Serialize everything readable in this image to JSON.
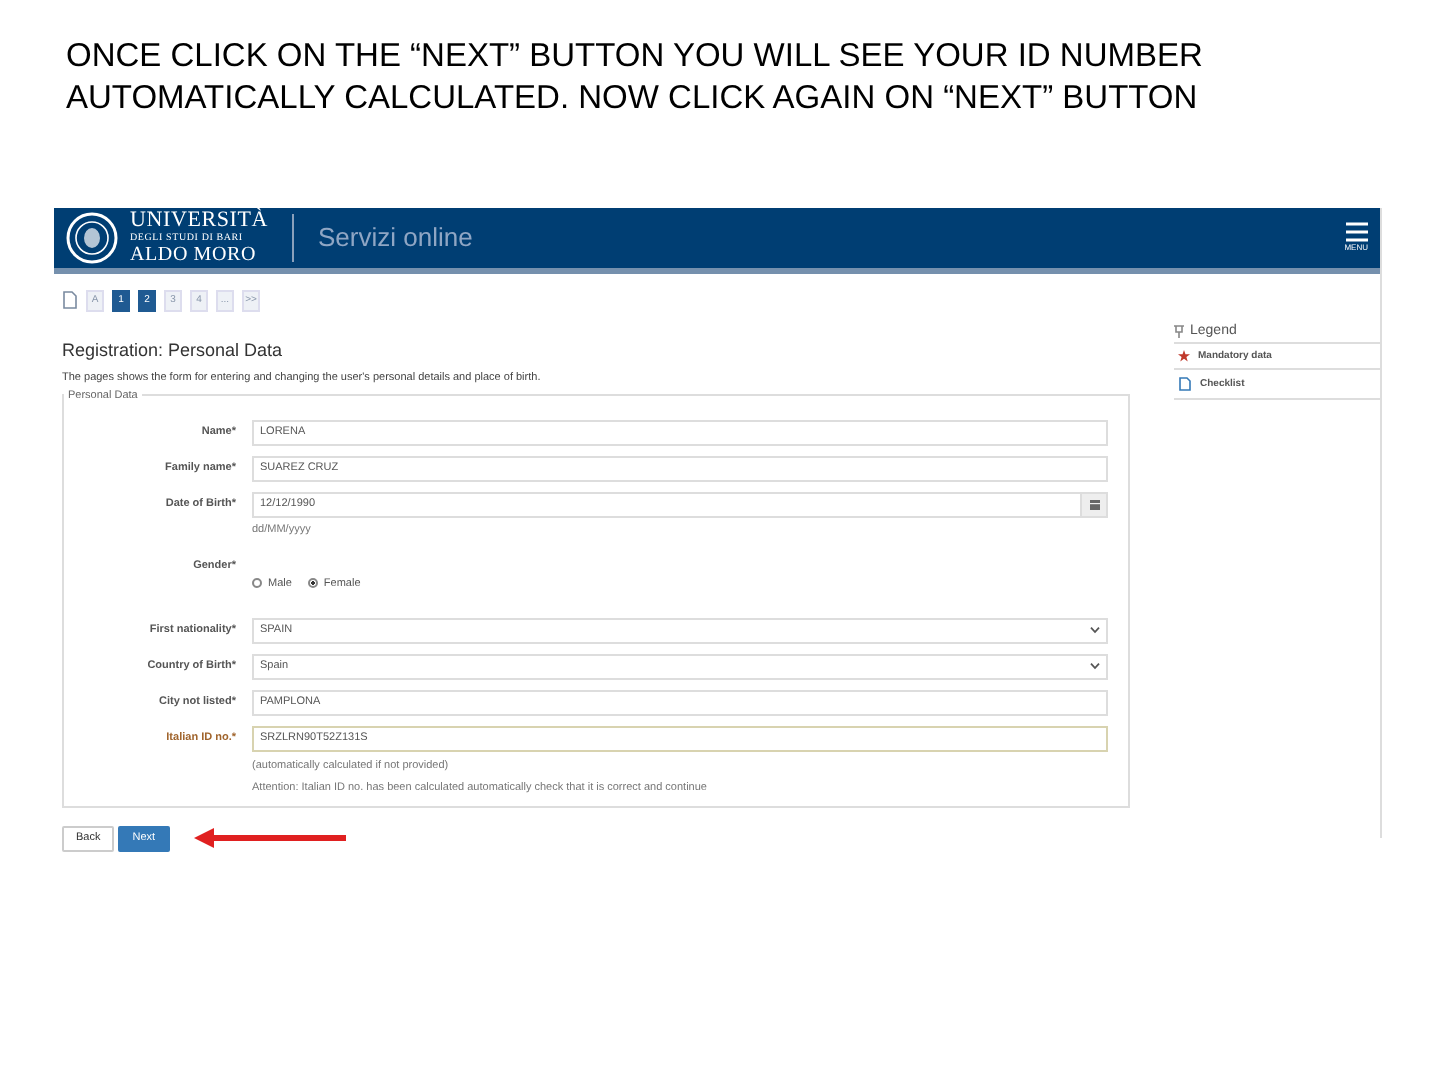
{
  "caption": {
    "lines": [
      "ONCE CLICK ON THE “NEXT” BUTTON YOU WILL SEE YOUR ID NUMBER",
      "AUTOMATICALLY CALCULATED. NOW CLICK AGAIN ON “NEXT” BUTTON"
    ]
  },
  "header": {
    "logo_lines": [
      "UNIVERSITÀ",
      "DEGLI STUDI DI BARI",
      "ALDO MORO"
    ],
    "service": "Servizi online",
    "menu_label": "MENU"
  },
  "steps": [
    {
      "label": "A",
      "active": false
    },
    {
      "label": "1",
      "active": true
    },
    {
      "label": "2",
      "active": true
    },
    {
      "label": "3",
      "active": false
    },
    {
      "label": "4",
      "active": false
    },
    {
      "label": "...",
      "active": false
    },
    {
      "label": ">>",
      "active": false
    }
  ],
  "page_title": "Registration: Personal Data",
  "description": "The pages shows the form for entering and changing the user's personal details and place of birth.",
  "fieldset_legend": "Personal Data",
  "fields": [
    {
      "kind": "text",
      "label": "Name*",
      "value": "LORENA",
      "highlighted": false
    },
    {
      "kind": "text",
      "label": "Family name*",
      "value": "SUAREZ CRUZ",
      "highlighted": false
    },
    {
      "kind": "date",
      "label": "Date of Birth*",
      "value": "12/12/1990",
      "hint": "dd/MM/yyyy",
      "highlighted": false
    },
    {
      "kind": "radio",
      "label": "Gender*",
      "options": [
        {
          "label": "Male",
          "selected": false
        },
        {
          "label": "Female",
          "selected": true
        }
      ]
    },
    {
      "kind": "select",
      "label": "First nationality*",
      "value": "SPAIN",
      "highlighted": false
    },
    {
      "kind": "select",
      "label": "Country of Birth*",
      "value": "Spain",
      "highlighted": false
    },
    {
      "kind": "text",
      "label": "City not listed*",
      "value": "PAMPLONA",
      "highlighted": false
    },
    {
      "kind": "text",
      "label": "Italian ID no.*",
      "value": "SRZLRN90T52Z131S",
      "highlighted": true,
      "notes": [
        "(automatically calculated if not provided)",
        "Attention: Italian ID no. has been calculated automatically check that it is correct and continue"
      ]
    }
  ],
  "buttons": [
    {
      "label": "Back",
      "primary": false
    },
    {
      "label": "Next",
      "primary": true
    }
  ],
  "legend": {
    "title": "Legend",
    "items": [
      {
        "kind": "mandatory",
        "label": "Mandatory data"
      },
      {
        "kind": "checklist",
        "label": "Checklist"
      }
    ]
  }
}
